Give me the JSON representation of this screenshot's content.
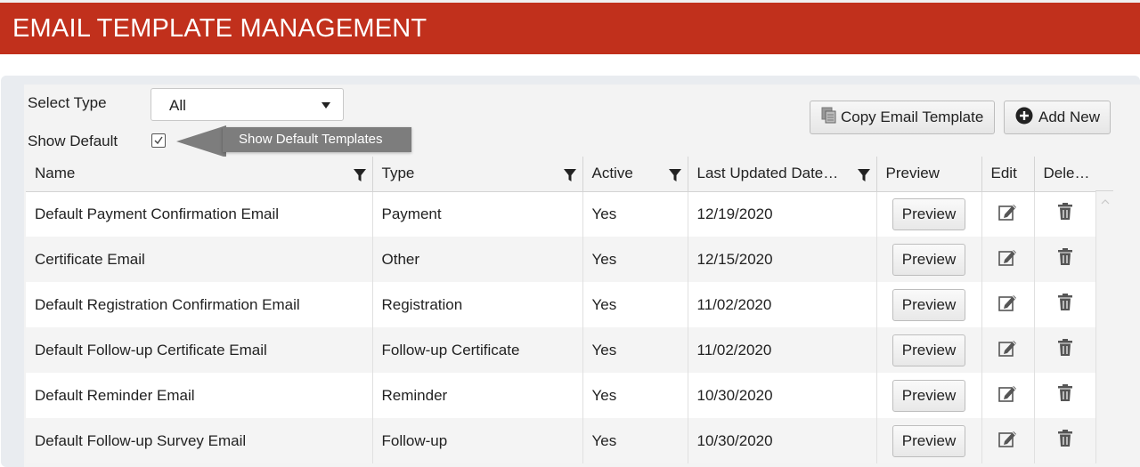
{
  "header": {
    "title": "EMAIL TEMPLATE MANAGEMENT"
  },
  "filters": {
    "select_type_label": "Select Type",
    "select_type_value": "All",
    "show_default_label": "Show Default",
    "show_default_checked": true,
    "tooltip": "Show Default Templates"
  },
  "toolbar": {
    "copy_label": "Copy Email Template",
    "add_label": "Add New"
  },
  "table": {
    "columns": [
      "Name",
      "Type",
      "Active",
      "Last Updated Date…",
      "Preview",
      "Edit",
      "Dele…"
    ],
    "preview_label": "Preview",
    "rows": [
      {
        "name": "Default Payment Confirmation Email",
        "type": "Payment",
        "active": "Yes",
        "date": "12/19/2020"
      },
      {
        "name": "Certificate Email",
        "type": "Other",
        "active": "Yes",
        "date": "12/15/2020"
      },
      {
        "name": "Default Registration Confirmation Email",
        "type": "Registration",
        "active": "Yes",
        "date": "11/02/2020"
      },
      {
        "name": "Default Follow-up Certificate Email",
        "type": "Follow-up Certificate",
        "active": "Yes",
        "date": "11/02/2020"
      },
      {
        "name": "Default Reminder Email",
        "type": "Reminder",
        "active": "Yes",
        "date": "10/30/2020"
      },
      {
        "name": "Default Follow-up Survey Email",
        "type": "Follow-up",
        "active": "Yes",
        "date": "10/30/2020"
      }
    ]
  },
  "colors": {
    "brand": "#c1301c",
    "tooltip": "#7d7d7d"
  },
  "icons": [
    "copy-icon",
    "plus-circle-icon",
    "filter-icon",
    "edit-icon",
    "trash-icon",
    "chevron-up-icon",
    "checkmark-icon"
  ]
}
